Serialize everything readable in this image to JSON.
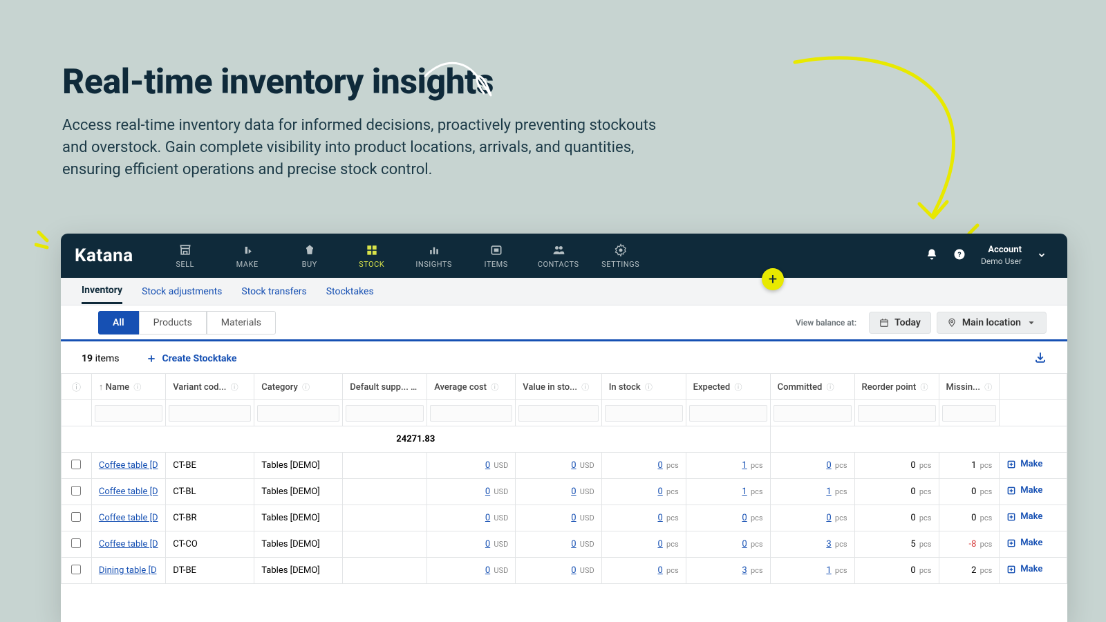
{
  "hero": {
    "title": "Real-time inventory insights",
    "subtitle": "Access real-time inventory data for informed decisions, proactively preventing stockouts and overstock. Gain complete visibility into product locations, arrivals, and quantities, ensuring efficient operations and precise stock control."
  },
  "brand": "Katana",
  "nav": [
    {
      "label": "SELL",
      "icon": "store-icon"
    },
    {
      "label": "MAKE",
      "icon": "make-icon"
    },
    {
      "label": "BUY",
      "icon": "cart-icon"
    },
    {
      "label": "STOCK",
      "icon": "stock-icon"
    },
    {
      "label": "INSIGHTS",
      "icon": "chart-icon"
    },
    {
      "label": "ITEMS",
      "icon": "items-icon"
    },
    {
      "label": "CONTACTS",
      "icon": "contacts-icon"
    },
    {
      "label": "SETTINGS",
      "icon": "gear-icon"
    }
  ],
  "nav_active_index": 3,
  "account": {
    "label": "Account",
    "user": "Demo User"
  },
  "subtabs": [
    "Inventory",
    "Stock adjustments",
    "Stock transfers",
    "Stocktakes"
  ],
  "subtab_active_index": 0,
  "pill_tabs": [
    "All",
    "Products",
    "Materials"
  ],
  "pill_active_index": 0,
  "balance_label": "View balance at:",
  "chip_today": "Today",
  "chip_location": "Main location",
  "count_number": "19",
  "count_label": "items",
  "create_label": "Create Stocktake",
  "columns": [
    "Name",
    "Variant cod...",
    "Category",
    "Default supp...",
    "Average cost",
    "Value in sto...",
    "In stock",
    "Expected",
    "Committed",
    "Reorder point",
    "Missin..."
  ],
  "sort_arrow": "↑",
  "sum_value": "24271.83",
  "usd": "USD",
  "pcs": "pcs",
  "make_label": "Make",
  "rows": [
    {
      "name": "Coffee table [D",
      "variant": "CT-BE",
      "category": "Tables [DEMO]",
      "avg": "0",
      "value": "0",
      "stock": "0",
      "expected": "1",
      "committed": "0",
      "reorder": "0",
      "missing": "1"
    },
    {
      "name": "Coffee table [D",
      "variant": "CT-BL",
      "category": "Tables [DEMO]",
      "avg": "0",
      "value": "0",
      "stock": "0",
      "expected": "1",
      "committed": "1",
      "reorder": "0",
      "missing": "0"
    },
    {
      "name": "Coffee table [D",
      "variant": "CT-BR",
      "category": "Tables [DEMO]",
      "avg": "0",
      "value": "0",
      "stock": "0",
      "expected": "0",
      "committed": "0",
      "reorder": "0",
      "missing": "0"
    },
    {
      "name": "Coffee table [D",
      "variant": "CT-CO",
      "category": "Tables [DEMO]",
      "avg": "0",
      "value": "0",
      "stock": "0",
      "expected": "0",
      "committed": "3",
      "reorder": "5",
      "missing": "-8"
    },
    {
      "name": "Dining table [D",
      "variant": "DT-BE",
      "category": "Tables [DEMO]",
      "avg": "0",
      "value": "0",
      "stock": "0",
      "expected": "3",
      "committed": "1",
      "reorder": "0",
      "missing": "2"
    }
  ]
}
